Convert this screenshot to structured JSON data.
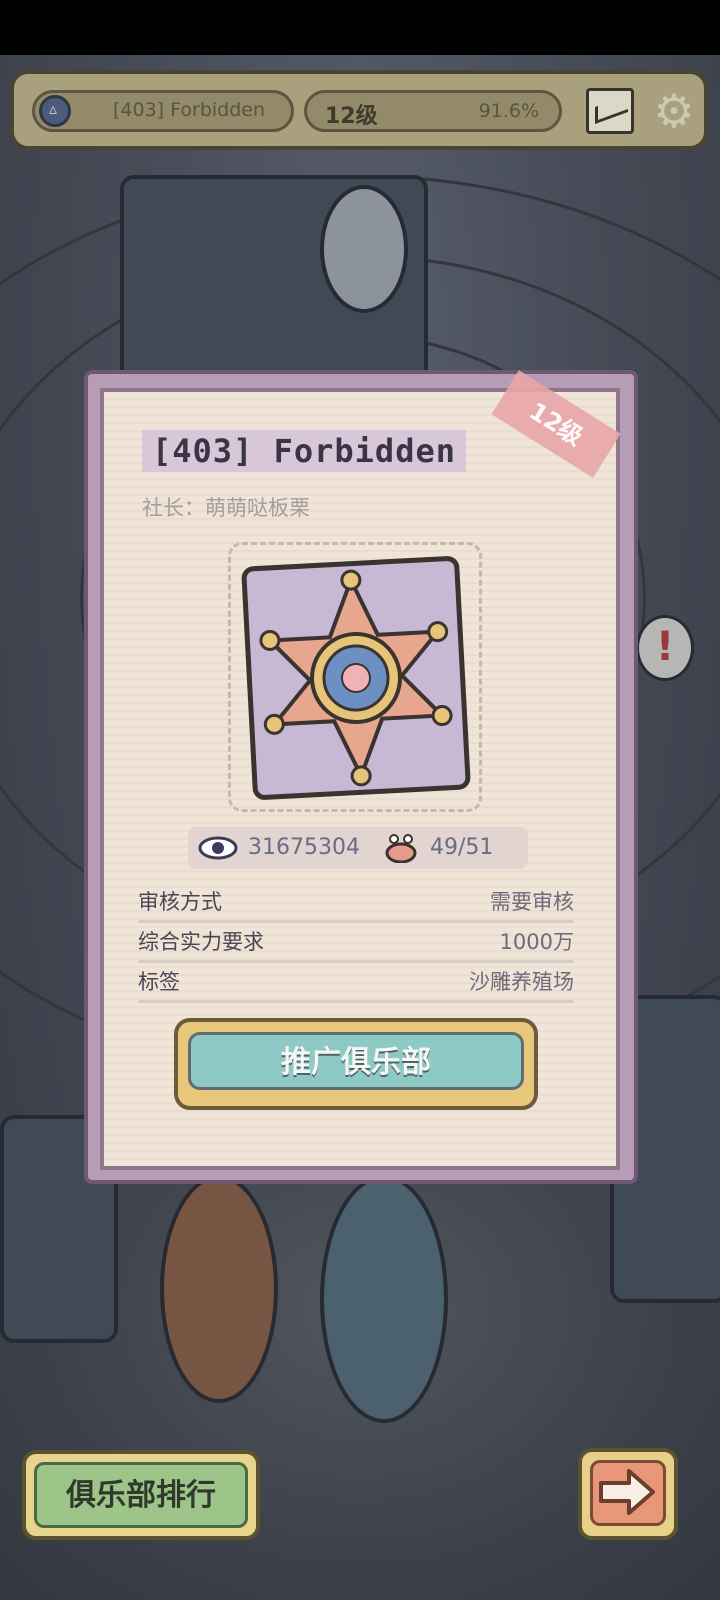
{
  "top_bar": {
    "club_name": "[403] Forbidden",
    "level": "12级",
    "progress_text": "91.6%"
  },
  "club_card": {
    "title": "[403] Forbidden",
    "level_stamp": "12级",
    "owner": "社长：萌萌哒板栗",
    "views": "31675304",
    "members": "49/51",
    "info": [
      {
        "label": "审核方式",
        "value": "需要审核"
      },
      {
        "label": "综合实力要求",
        "value": "1000万"
      },
      {
        "label": "标签",
        "value": "沙雕养殖场"
      }
    ],
    "promote_button": "推广俱乐部"
  },
  "bottom": {
    "ranking_button": "俱乐部排行"
  },
  "colors": {
    "card_bg": "#efe4d7",
    "card_border": "#8c7687",
    "promote_button": "#8fc9c6",
    "ranking_button": "#9dc58a",
    "next_button": "#e89878"
  }
}
